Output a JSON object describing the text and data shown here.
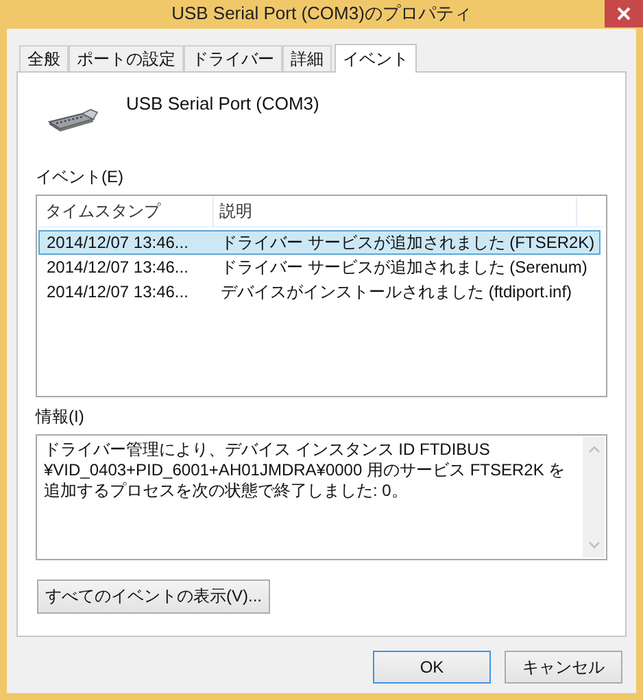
{
  "window": {
    "title": "USB Serial Port (COM3)のプロパティ"
  },
  "tabs": [
    {
      "label": "全般",
      "selected": false
    },
    {
      "label": "ポートの設定",
      "selected": false
    },
    {
      "label": "ドライバー",
      "selected": false
    },
    {
      "label": "詳細",
      "selected": false
    },
    {
      "label": "イベント",
      "selected": true
    }
  ],
  "device": {
    "name": "USB Serial Port (COM3)"
  },
  "events": {
    "label": "イベント(E)",
    "columns": [
      "タイムスタンプ",
      "説明"
    ],
    "rows": [
      {
        "timestamp": "2014/12/07 13:46...",
        "description": "ドライバー サービスが追加されました (FTSER2K)",
        "selected": true
      },
      {
        "timestamp": "2014/12/07 13:46...",
        "description": "ドライバー サービスが追加されました (Serenum)",
        "selected": false
      },
      {
        "timestamp": "2014/12/07 13:46...",
        "description": "デバイスがインストールされました (ftdiport.inf)",
        "selected": false
      }
    ]
  },
  "info": {
    "label": "情報(I)",
    "value": "ドライバー管理により、デバイス インスタンス ID FTDIBUS\n¥VID_0403+PID_6001+AH01JMDRA¥0000 用のサービス FTSER2K を追加するプロセスを次の状態で終了しました: 0。"
  },
  "view_all_button": "すべてのイベントの表示(V)...",
  "buttons": [
    "OK",
    "キャンセル"
  ]
}
